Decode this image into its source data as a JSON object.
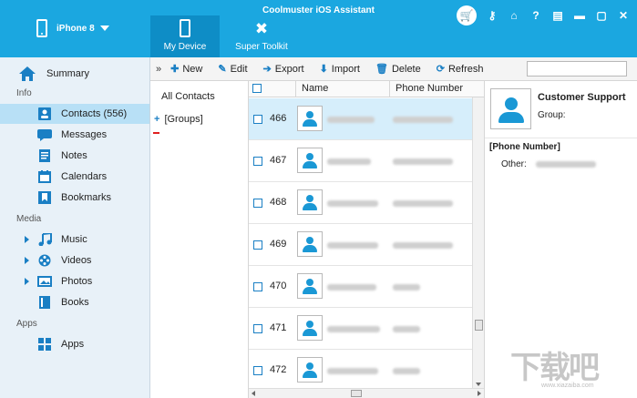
{
  "app": {
    "title": "Coolmuster iOS Assistant"
  },
  "device": {
    "name": "iPhone 8"
  },
  "nav_tabs": [
    {
      "label": "My Device",
      "icon": "phone-icon",
      "active": true
    },
    {
      "label": "Super Toolkit",
      "icon": "tools-icon",
      "active": false
    }
  ],
  "window_controls": [
    "cart-icon",
    "key-icon",
    "home-icon",
    "help-icon",
    "feedback-icon",
    "minimize-icon",
    "maximize-icon",
    "close-icon"
  ],
  "window_glyphs": {
    "key": "⚷",
    "home": "⌂",
    "help": "?",
    "feedback": "▤",
    "minimize": "▬",
    "maximize": "▢",
    "close": "✕"
  },
  "sidebar": {
    "summary": "Summary",
    "sections": [
      {
        "title": "Info",
        "items": [
          {
            "label": "Contacts  (556)",
            "icon": "contacts-icon",
            "selected": true
          },
          {
            "label": "Messages",
            "icon": "messages-icon"
          },
          {
            "label": "Notes",
            "icon": "notes-icon"
          },
          {
            "label": "Calendars",
            "icon": "calendars-icon"
          },
          {
            "label": "Bookmarks",
            "icon": "bookmarks-icon"
          }
        ]
      },
      {
        "title": "Media",
        "items": [
          {
            "label": "Music",
            "icon": "music-icon",
            "expandable": true
          },
          {
            "label": "Videos",
            "icon": "videos-icon",
            "expandable": true
          },
          {
            "label": "Photos",
            "icon": "photos-icon",
            "expandable": true
          },
          {
            "label": "Books",
            "icon": "books-icon"
          }
        ]
      },
      {
        "title": "Apps",
        "items": [
          {
            "label": "Apps",
            "icon": "apps-icon"
          }
        ]
      }
    ]
  },
  "toolbar": {
    "more": "»",
    "buttons": [
      {
        "label": "New",
        "glyph": "✚",
        "icon": "new-icon"
      },
      {
        "label": "Edit",
        "glyph": "✎",
        "icon": "edit-icon"
      },
      {
        "label": "Export",
        "glyph": "➔",
        "icon": "export-icon"
      },
      {
        "label": "Import",
        "glyph": "⬇",
        "icon": "import-icon"
      },
      {
        "label": "Delete",
        "glyph": "🗑",
        "icon": "delete-icon"
      },
      {
        "label": "Refresh",
        "glyph": "⟳",
        "icon": "refresh-icon"
      }
    ]
  },
  "groups": {
    "all": "All Contacts",
    "groups": "[Groups]"
  },
  "table": {
    "columns": [
      "Name",
      "Phone Number"
    ],
    "rows": [
      {
        "num": "466",
        "selected": true
      },
      {
        "num": "467"
      },
      {
        "num": "468"
      },
      {
        "num": "469"
      },
      {
        "num": "470"
      },
      {
        "num": "471"
      },
      {
        "num": "472"
      }
    ]
  },
  "details": {
    "name": "Customer Support",
    "group_label": "Group:",
    "section": "[Phone Number]",
    "other_label": "Other:"
  },
  "watermark": {
    "text": "下载吧",
    "url": "www.xiazaiba.com"
  },
  "colors": {
    "accent": "#1ba7e0",
    "accent_dark": "#0e8dc6",
    "selected_row": "#d6eefb",
    "sidebar_bg": "#e8f1f8"
  }
}
